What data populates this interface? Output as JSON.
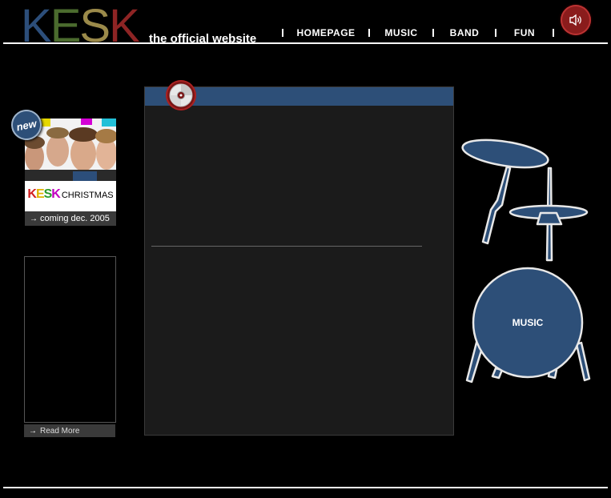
{
  "logo": {
    "letters": [
      "K",
      "E",
      "S",
      "K"
    ],
    "colors": [
      "#2c4e7a",
      "#4b6b2e",
      "#9b8a4a",
      "#8e2424"
    ]
  },
  "tagline": "the official website",
  "nav": {
    "items": [
      "HOMEPAGE",
      "MUSIC",
      "BAND",
      "FUN"
    ]
  },
  "icons": {
    "sound": "speaker-icon",
    "cd": "cd-icon",
    "drum": "drum-kit-icon",
    "arrow": "arrow-right-icon"
  },
  "promo": {
    "badge": "new",
    "title_letters": [
      "K",
      "E",
      "S",
      "K"
    ],
    "title_colors": [
      "#d21e1e",
      "#e0b400",
      "#2a9a2a",
      "#c000c0"
    ],
    "title_rest": "CHRISTMAS",
    "caption": "coming dec. 2005"
  },
  "news": {
    "read_more": "Read More"
  },
  "drum": {
    "label": "MUSIC",
    "color": "#2d4f78"
  },
  "colors": {
    "accent_blue": "#2d4f78",
    "accent_red": "#8a1c1c"
  }
}
